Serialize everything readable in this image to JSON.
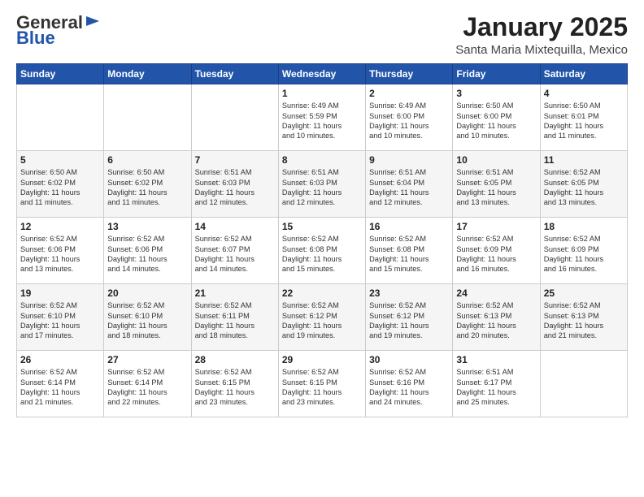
{
  "header": {
    "logo_general": "General",
    "logo_blue": "Blue",
    "month": "January 2025",
    "location": "Santa Maria Mixtequilla, Mexico"
  },
  "weekdays": [
    "Sunday",
    "Monday",
    "Tuesday",
    "Wednesday",
    "Thursday",
    "Friday",
    "Saturday"
  ],
  "weeks": [
    [
      {
        "day": "",
        "content": ""
      },
      {
        "day": "",
        "content": ""
      },
      {
        "day": "",
        "content": ""
      },
      {
        "day": "1",
        "content": "Sunrise: 6:49 AM\nSunset: 5:59 PM\nDaylight: 11 hours\nand 10 minutes."
      },
      {
        "day": "2",
        "content": "Sunrise: 6:49 AM\nSunset: 6:00 PM\nDaylight: 11 hours\nand 10 minutes."
      },
      {
        "day": "3",
        "content": "Sunrise: 6:50 AM\nSunset: 6:00 PM\nDaylight: 11 hours\nand 10 minutes."
      },
      {
        "day": "4",
        "content": "Sunrise: 6:50 AM\nSunset: 6:01 PM\nDaylight: 11 hours\nand 11 minutes."
      }
    ],
    [
      {
        "day": "5",
        "content": "Sunrise: 6:50 AM\nSunset: 6:02 PM\nDaylight: 11 hours\nand 11 minutes."
      },
      {
        "day": "6",
        "content": "Sunrise: 6:50 AM\nSunset: 6:02 PM\nDaylight: 11 hours\nand 11 minutes."
      },
      {
        "day": "7",
        "content": "Sunrise: 6:51 AM\nSunset: 6:03 PM\nDaylight: 11 hours\nand 12 minutes."
      },
      {
        "day": "8",
        "content": "Sunrise: 6:51 AM\nSunset: 6:03 PM\nDaylight: 11 hours\nand 12 minutes."
      },
      {
        "day": "9",
        "content": "Sunrise: 6:51 AM\nSunset: 6:04 PM\nDaylight: 11 hours\nand 12 minutes."
      },
      {
        "day": "10",
        "content": "Sunrise: 6:51 AM\nSunset: 6:05 PM\nDaylight: 11 hours\nand 13 minutes."
      },
      {
        "day": "11",
        "content": "Sunrise: 6:52 AM\nSunset: 6:05 PM\nDaylight: 11 hours\nand 13 minutes."
      }
    ],
    [
      {
        "day": "12",
        "content": "Sunrise: 6:52 AM\nSunset: 6:06 PM\nDaylight: 11 hours\nand 13 minutes."
      },
      {
        "day": "13",
        "content": "Sunrise: 6:52 AM\nSunset: 6:06 PM\nDaylight: 11 hours\nand 14 minutes."
      },
      {
        "day": "14",
        "content": "Sunrise: 6:52 AM\nSunset: 6:07 PM\nDaylight: 11 hours\nand 14 minutes."
      },
      {
        "day": "15",
        "content": "Sunrise: 6:52 AM\nSunset: 6:08 PM\nDaylight: 11 hours\nand 15 minutes."
      },
      {
        "day": "16",
        "content": "Sunrise: 6:52 AM\nSunset: 6:08 PM\nDaylight: 11 hours\nand 15 minutes."
      },
      {
        "day": "17",
        "content": "Sunrise: 6:52 AM\nSunset: 6:09 PM\nDaylight: 11 hours\nand 16 minutes."
      },
      {
        "day": "18",
        "content": "Sunrise: 6:52 AM\nSunset: 6:09 PM\nDaylight: 11 hours\nand 16 minutes."
      }
    ],
    [
      {
        "day": "19",
        "content": "Sunrise: 6:52 AM\nSunset: 6:10 PM\nDaylight: 11 hours\nand 17 minutes."
      },
      {
        "day": "20",
        "content": "Sunrise: 6:52 AM\nSunset: 6:10 PM\nDaylight: 11 hours\nand 18 minutes."
      },
      {
        "day": "21",
        "content": "Sunrise: 6:52 AM\nSunset: 6:11 PM\nDaylight: 11 hours\nand 18 minutes."
      },
      {
        "day": "22",
        "content": "Sunrise: 6:52 AM\nSunset: 6:12 PM\nDaylight: 11 hours\nand 19 minutes."
      },
      {
        "day": "23",
        "content": "Sunrise: 6:52 AM\nSunset: 6:12 PM\nDaylight: 11 hours\nand 19 minutes."
      },
      {
        "day": "24",
        "content": "Sunrise: 6:52 AM\nSunset: 6:13 PM\nDaylight: 11 hours\nand 20 minutes."
      },
      {
        "day": "25",
        "content": "Sunrise: 6:52 AM\nSunset: 6:13 PM\nDaylight: 11 hours\nand 21 minutes."
      }
    ],
    [
      {
        "day": "26",
        "content": "Sunrise: 6:52 AM\nSunset: 6:14 PM\nDaylight: 11 hours\nand 21 minutes."
      },
      {
        "day": "27",
        "content": "Sunrise: 6:52 AM\nSunset: 6:14 PM\nDaylight: 11 hours\nand 22 minutes."
      },
      {
        "day": "28",
        "content": "Sunrise: 6:52 AM\nSunset: 6:15 PM\nDaylight: 11 hours\nand 23 minutes."
      },
      {
        "day": "29",
        "content": "Sunrise: 6:52 AM\nSunset: 6:15 PM\nDaylight: 11 hours\nand 23 minutes."
      },
      {
        "day": "30",
        "content": "Sunrise: 6:52 AM\nSunset: 6:16 PM\nDaylight: 11 hours\nand 24 minutes."
      },
      {
        "day": "31",
        "content": "Sunrise: 6:51 AM\nSunset: 6:17 PM\nDaylight: 11 hours\nand 25 minutes."
      },
      {
        "day": "",
        "content": ""
      }
    ]
  ]
}
